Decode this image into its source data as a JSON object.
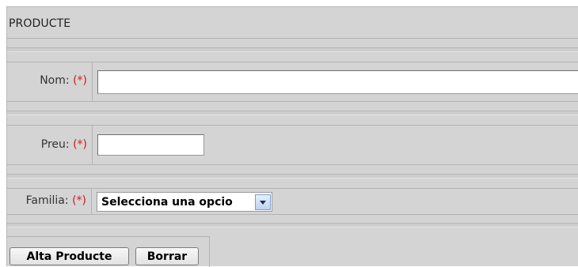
{
  "form": {
    "title": "PRODUCTE",
    "required_marker": "(*)",
    "fields": {
      "nom": {
        "label": "Nom:",
        "value": ""
      },
      "preu": {
        "label": "Preu:",
        "value": ""
      },
      "familia": {
        "label": "Familia:",
        "selected": "Selecciona una opcio"
      }
    },
    "buttons": {
      "submit": "Alta Producte",
      "reset": "Borrar"
    }
  }
}
